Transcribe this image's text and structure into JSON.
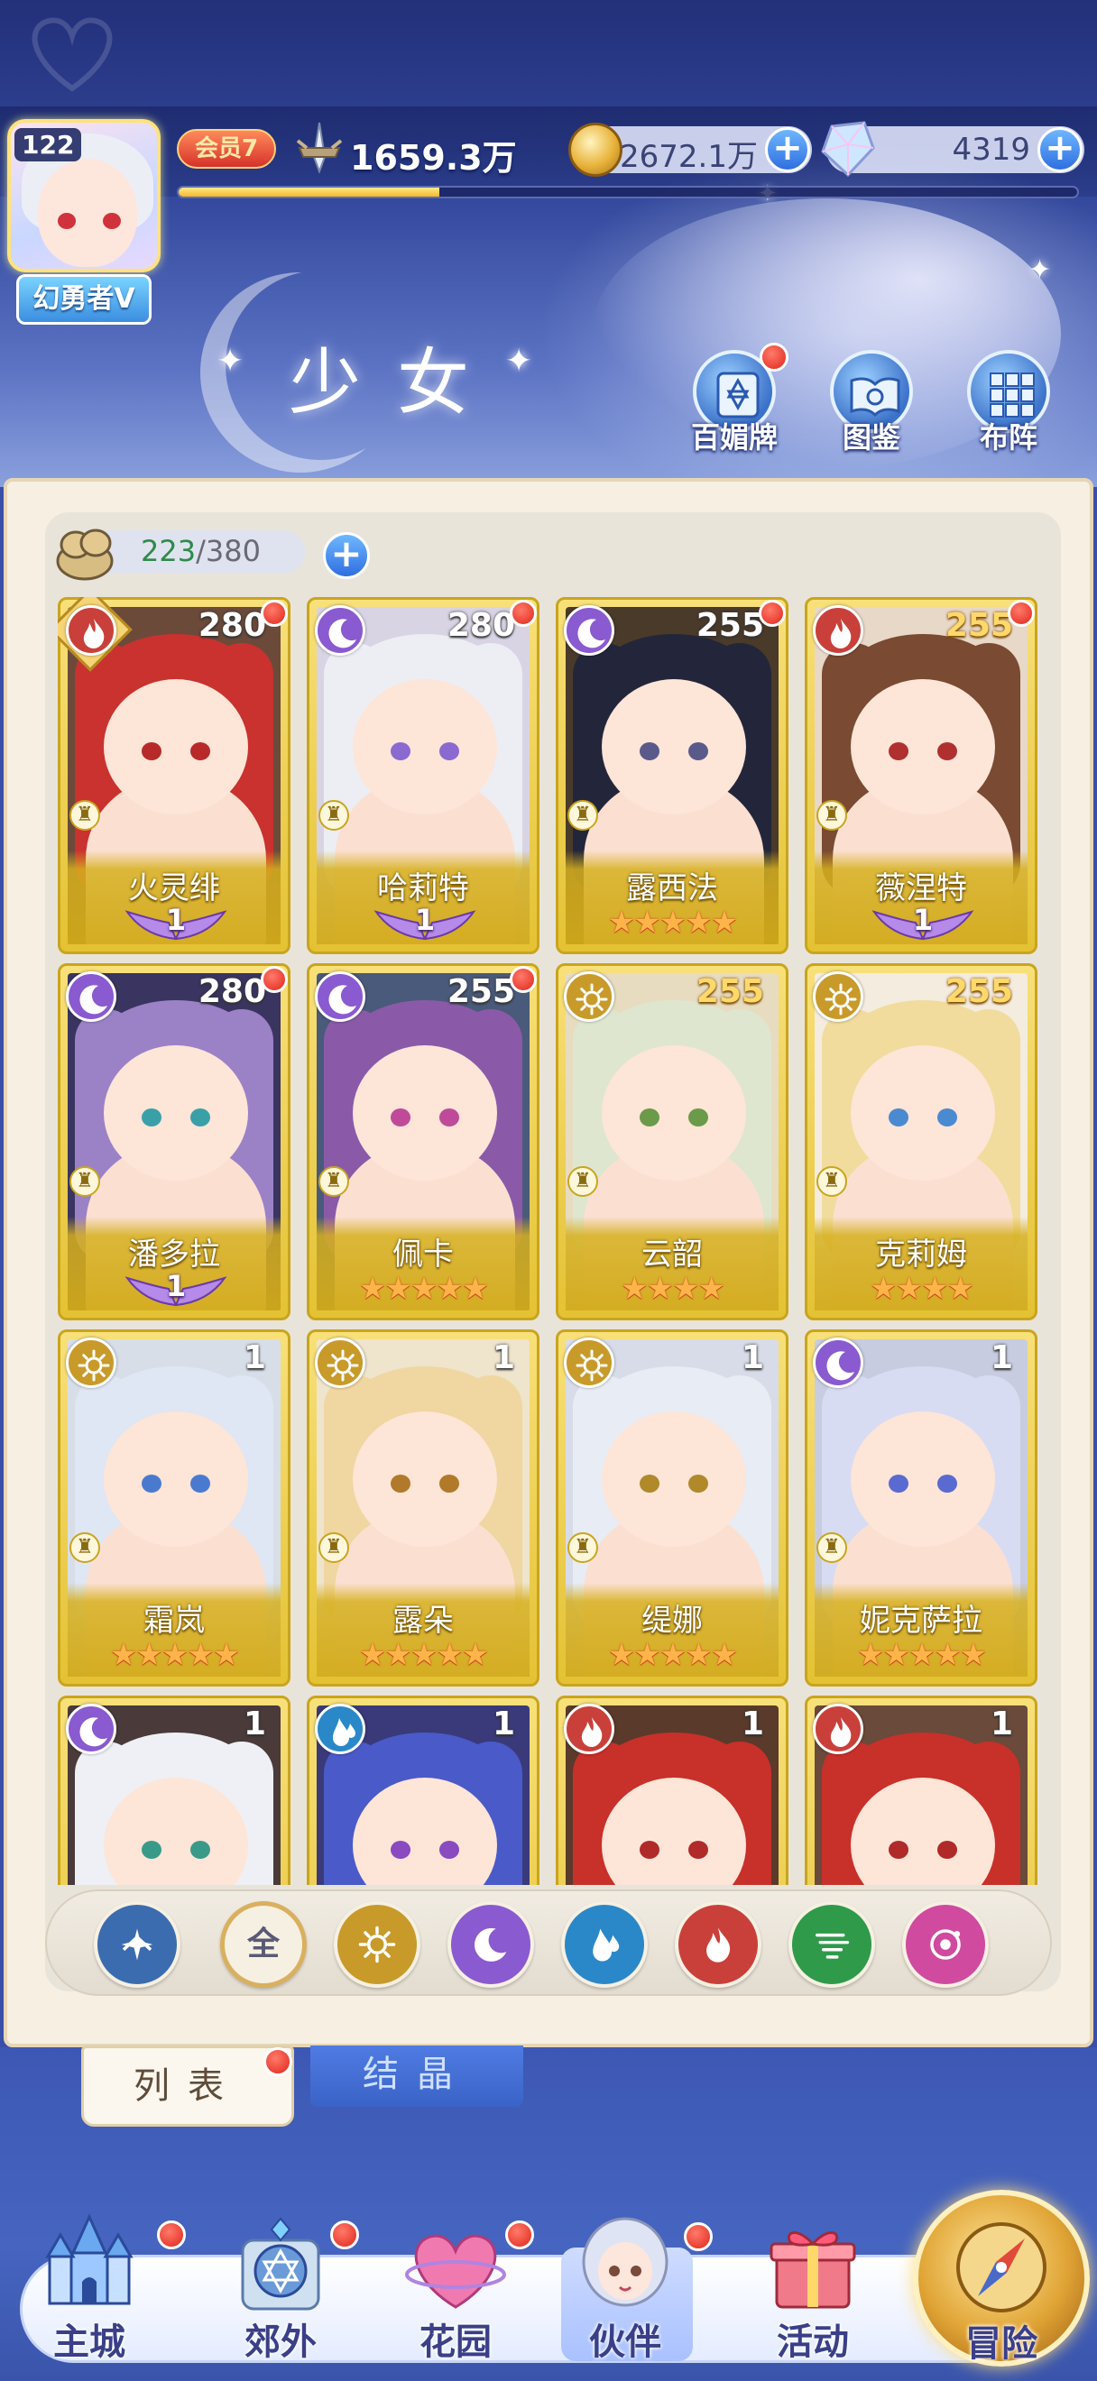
{
  "player": {
    "level": "122",
    "title": "幻勇者V",
    "vip": "会员7",
    "power": "1659.3万",
    "exp_fraction": 0.29
  },
  "resources": {
    "gold": "2672.1万",
    "gems": "4319"
  },
  "page_title": "少女",
  "header_buttons": {
    "baimeipai": "百媚牌",
    "tujian": "图鉴",
    "buzhen": "布阵"
  },
  "capacity": {
    "current": "223",
    "separator_max": "/380"
  },
  "cards": [
    {
      "name": "火灵绯",
      "level": "280",
      "element": "fire",
      "rank": "wings",
      "wings": "1",
      "dot": true,
      "diamond": true,
      "hair": "#c9322e",
      "eye": "#b82a2a",
      "bg": "#6b4a3a"
    },
    {
      "name": "哈莉特",
      "level": "280",
      "element": "moon",
      "rank": "wings",
      "wings": "1",
      "dot": true,
      "hair": "#eceef4",
      "eye": "#8a6ad0",
      "bg": "#d8d4e4"
    },
    {
      "name": "露西法",
      "level": "255",
      "element": "moon",
      "rank": "stars",
      "stars": 5,
      "dot": true,
      "hair": "#23263a",
      "eye": "#5a5a8a",
      "bg": "#4a3a2a"
    },
    {
      "name": "薇涅特",
      "level": "255",
      "element": "fire",
      "rank": "wings",
      "wings": "1",
      "dot": true,
      "gold": true,
      "hair": "#7a4a32",
      "eye": "#b03030",
      "bg": "#e8d8c8"
    },
    {
      "name": "潘多拉",
      "level": "280",
      "element": "moon",
      "rank": "wings",
      "wings": "1",
      "dot": true,
      "hair": "#9b82c6",
      "eye": "#3aa0a8",
      "bg": "#3a3560"
    },
    {
      "name": "佩卡",
      "level": "255",
      "element": "moon",
      "rank": "stars",
      "stars": 5,
      "dot": true,
      "hair": "#8a5aa8",
      "eye": "#c04a9a",
      "bg": "#4a5a7a"
    },
    {
      "name": "云韶",
      "level": "255",
      "element": "sun",
      "rank": "stars",
      "stars": 4,
      "gold": true,
      "hair": "#dfe6d0",
      "eye": "#6a9a4a",
      "bg": "#e8dcc0"
    },
    {
      "name": "克莉姆",
      "level": "255",
      "element": "sun",
      "rank": "stars",
      "stars": 4,
      "gold": true,
      "hair": "#f1dc9e",
      "eye": "#4a8ad0",
      "bg": "#f4ecde"
    },
    {
      "name": "霜岚",
      "level": "1",
      "element": "sun",
      "rank": "stars",
      "stars": 5,
      "hair": "#dfe6f4",
      "eye": "#4a7ad0",
      "bg": "#d8dee8"
    },
    {
      "name": "露朵",
      "level": "1",
      "element": "sun",
      "rank": "stars",
      "stars": 5,
      "hair": "#f0d6a0",
      "eye": "#b07a2a",
      "bg": "#efe4cc"
    },
    {
      "name": "缇娜",
      "level": "1",
      "element": "sun",
      "rank": "stars",
      "stars": 5,
      "hair": "#e8ecf4",
      "eye": "#b08a2a",
      "bg": "#d8dce8"
    },
    {
      "name": "妮克萨拉",
      "level": "1",
      "element": "moon",
      "rank": "stars",
      "stars": 5,
      "hair": "#d8dcf2",
      "eye": "#5a6ad0",
      "bg": "#c8cce0"
    },
    {
      "name": "",
      "level": "1",
      "element": "moon",
      "rank": "none",
      "hair": "#eef0f6",
      "eye": "#3a9a8a",
      "bg": "#4a3a3a"
    },
    {
      "name": "",
      "level": "1",
      "element": "water",
      "rank": "none",
      "hair": "#4a5ac8",
      "eye": "#8a4ac0",
      "bg": "#3a3a7a"
    },
    {
      "name": "",
      "level": "1",
      "element": "fire",
      "rank": "none",
      "hair": "#c8302a",
      "eye": "#b02a2a",
      "bg": "#5a3a2a"
    },
    {
      "name": "",
      "level": "1",
      "element": "fire",
      "rank": "none",
      "hair": "#c8302a",
      "eye": "#b02a2a",
      "bg": "#6a4a3a"
    }
  ],
  "filters": {
    "all_label": "全",
    "items": [
      "star-sword",
      "all",
      "sun",
      "moon",
      "water",
      "fire",
      "wind",
      "orb"
    ]
  },
  "tabs": {
    "list": "列表",
    "crystal": "结晶"
  },
  "nav": {
    "main_city": "主城",
    "suburb": "郊外",
    "garden": "花园",
    "partner": "伙伴",
    "activity": "活动",
    "adventure": "冒险"
  },
  "colors": {
    "fire": "#c9403a",
    "moon": "#8a5ad0",
    "sun": "#c89a2a",
    "water": "#2a88c8",
    "wind": "#2f9a4a",
    "orb": "#d04aa0",
    "star_sword": "#3c6cb0",
    "card_gold": "#e4c233"
  }
}
